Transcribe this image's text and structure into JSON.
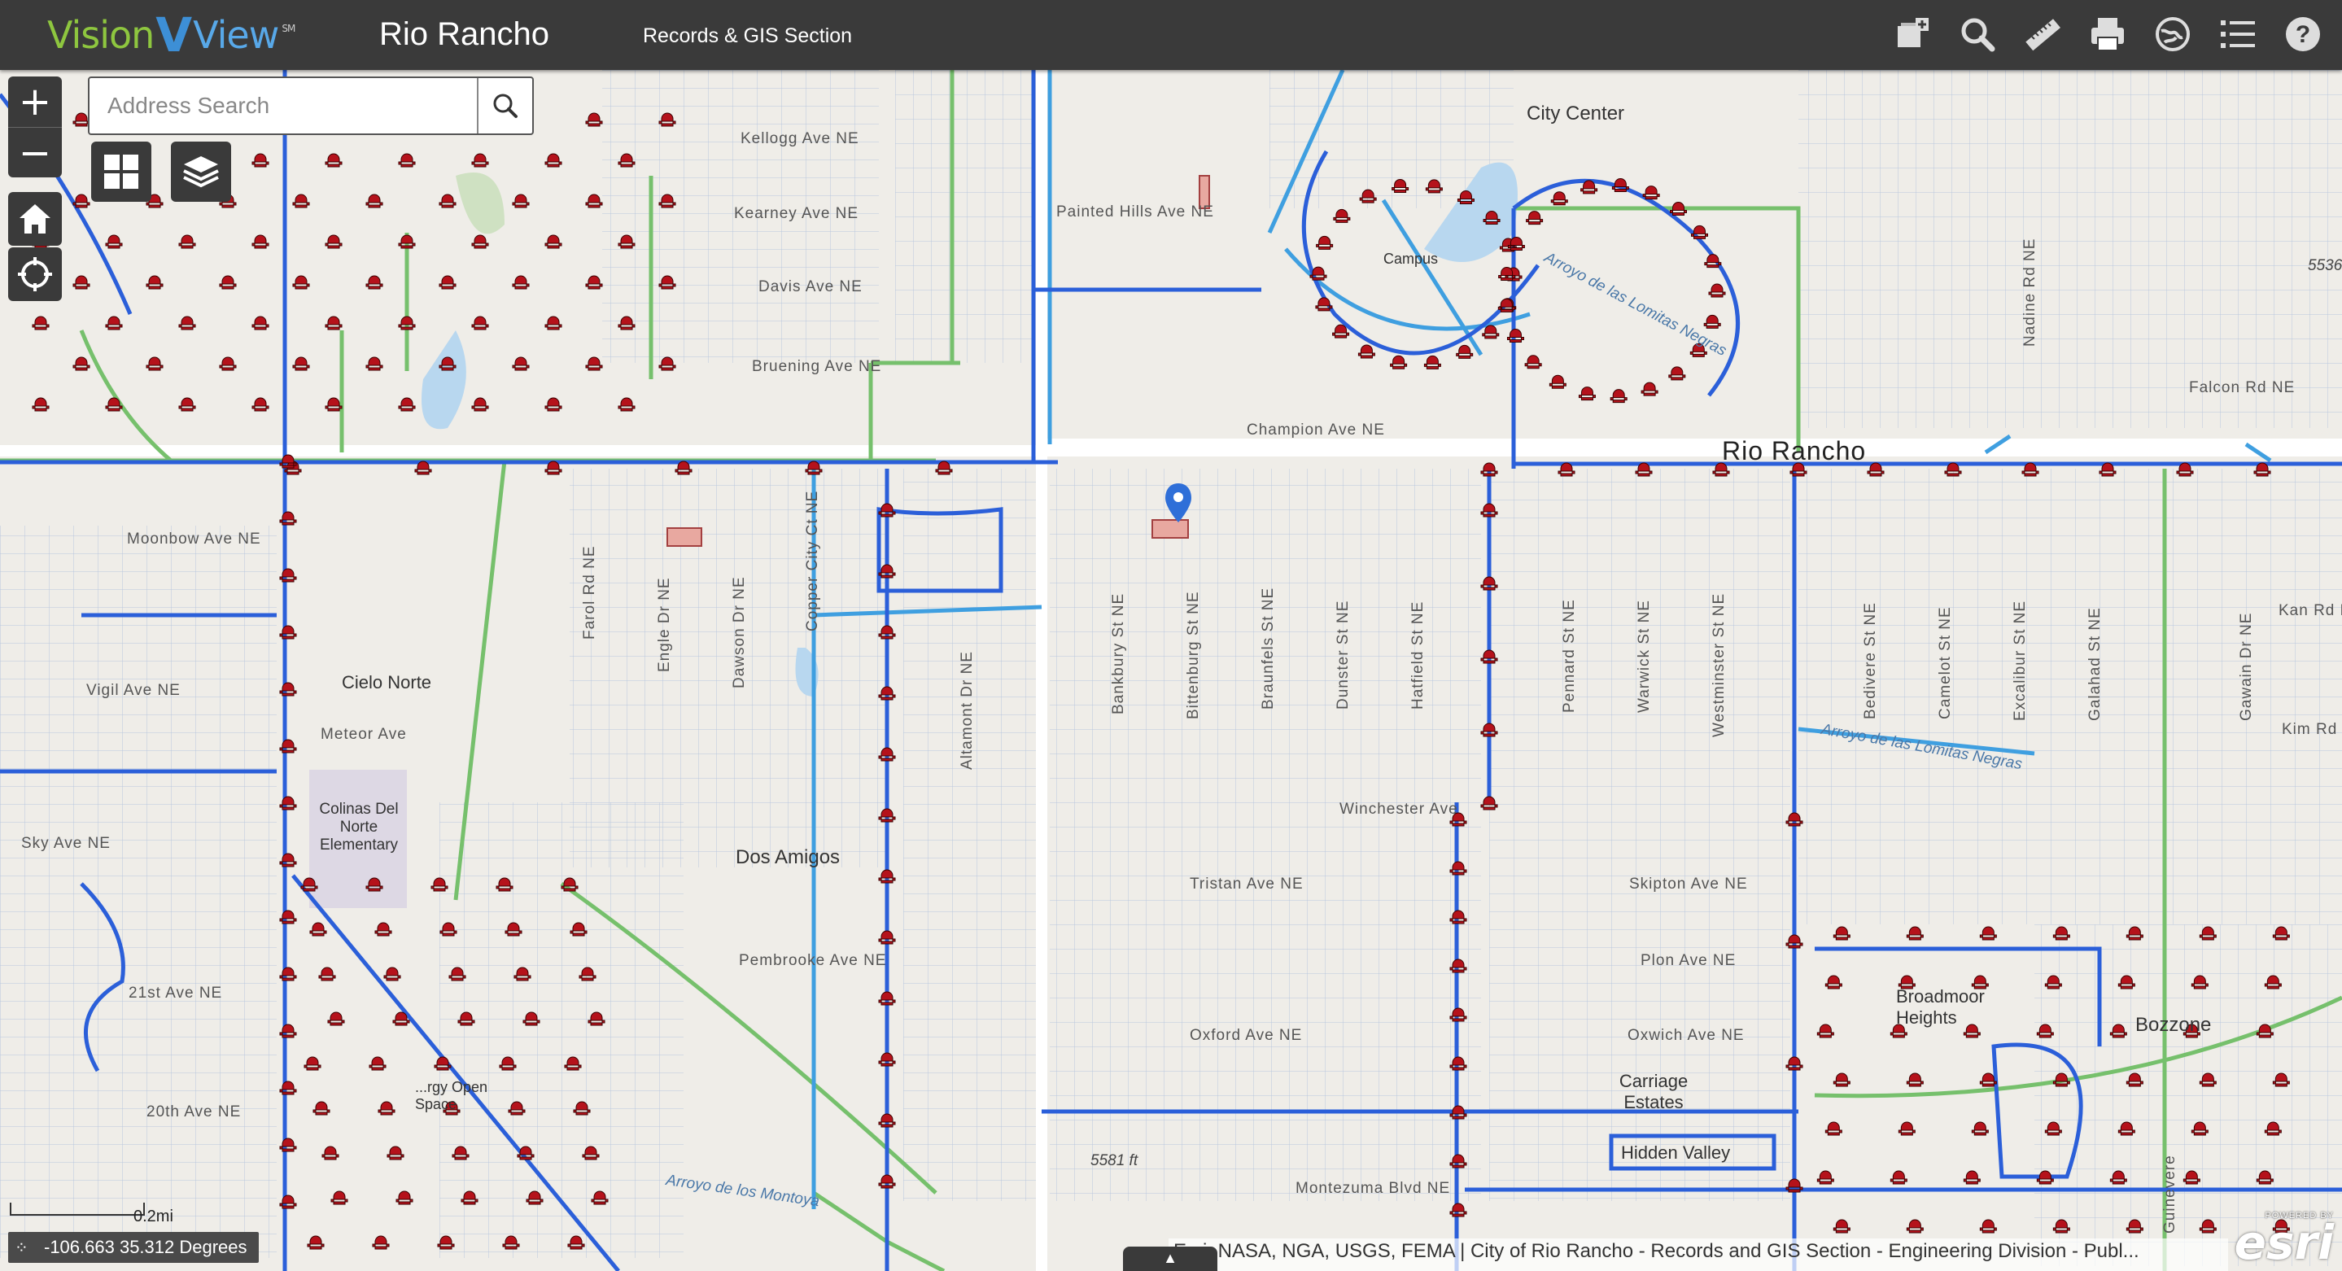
{
  "header": {
    "logo_vision": "Vision",
    "logo_v": "V",
    "logo_view": "View",
    "logo_sm": "SM",
    "app_title": "Rio Rancho",
    "section_title": "Records & GIS Section"
  },
  "toolbar": {
    "icons": [
      "add-note-icon",
      "search-icon",
      "measure-icon",
      "print-icon",
      "basemap-icon",
      "legend-icon",
      "help-icon"
    ]
  },
  "search": {
    "placeholder": "Address Search",
    "value": ""
  },
  "zoom": {
    "in_label": "+",
    "out_label": "−"
  },
  "scalebar": {
    "label": "0.2mi"
  },
  "coords": {
    "text": "-106.663 35.312 Degrees"
  },
  "attribution": "Esri, NASA, NGA, USGS, FEMA | City of Rio Rancho - Records and GIS Section - Engineering Division - Publ...",
  "esri": {
    "powered": "POWERED BY",
    "logo": "esri"
  },
  "colors": {
    "main_line": "#2b5fd9",
    "service_line": "#3f9fe0",
    "green_line": "#76c06c",
    "hydrant": "#b5121b",
    "header_bg": "#3a3a3a"
  },
  "map": {
    "places": [
      {
        "id": "rio-rancho",
        "text": "Rio Rancho"
      },
      {
        "id": "city-center",
        "text": "City Center"
      },
      {
        "id": "dos-amigos",
        "text": "Dos Amigos"
      },
      {
        "id": "bozzone",
        "text": "Bozzone"
      },
      {
        "id": "cielo-norte",
        "text": "Cielo Norte"
      },
      {
        "id": "campus",
        "text": "Campus"
      },
      {
        "id": "colinas",
        "text": "Colinas Del Norte Elementary"
      },
      {
        "id": "open-space",
        "text": "...rgy Open Space"
      },
      {
        "id": "broadmoor",
        "text": "Broadmoor Heights"
      },
      {
        "id": "carriage",
        "text": "Carriage Estates"
      },
      {
        "id": "hidden",
        "text": "Hidden Valley"
      }
    ],
    "streets_h": [
      "Kellogg Ave NE",
      "Kearney Ave NE",
      "Painted Hills Ave NE",
      "Davis Ave NE",
      "Bruening Ave NE",
      "Champion Ave NE",
      "Moonbow Ave NE",
      "Meteor Ave",
      "Winchester Ave",
      "Tristan Ave NE",
      "Skipton Ave NE",
      "Pembrooke Ave NE",
      "Plon Ave NE",
      "Oxford Ave NE",
      "Oxwich Ave NE",
      "Montezuma Blvd NE",
      "21st Ave NE",
      "20th Ave NE",
      "Falcon Rd NE",
      "Sky Ave NE",
      "Kan Rd NE",
      "Kim Rd NE",
      "Vigil Ave NE"
    ],
    "streets_v": [
      "Farol Rd NE",
      "Engle Dr NE",
      "Dawson Dr NE",
      "Copper City Ct NE",
      "Altamont Dr NE",
      "Bankbury St NE",
      "Bittenburg St NE",
      "Braunfels St NE",
      "Dunster St NE",
      "Hatfield St NE",
      "Pennard St NE",
      "Warwick St NE",
      "Westminster St NE",
      "Bedivere St NE",
      "Camelot St NE",
      "Excalibur St NE",
      "Galahad St NE",
      "Gawain Dr NE",
      "Nadine Rd NE",
      "Guinevere"
    ],
    "water": [
      "Arroyo de las Lomitas Negras",
      "Arroyo de los Montoya",
      "Arroyo de las Lomitas Negras"
    ],
    "elevations": [
      "5581 ft",
      "5536"
    ]
  }
}
